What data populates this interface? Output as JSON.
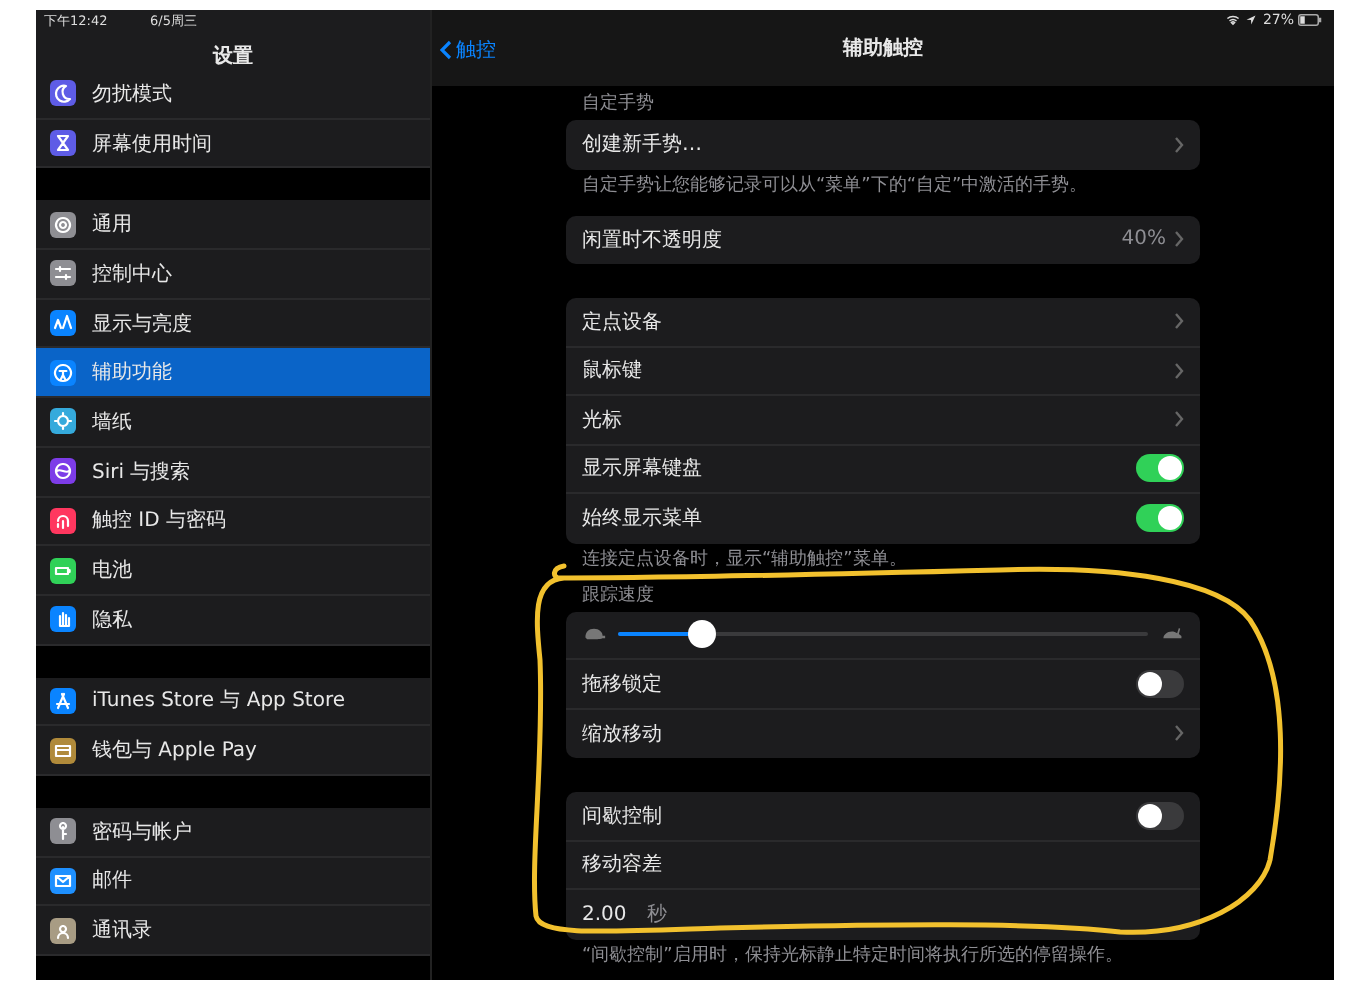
{
  "status_bar": {
    "time": "下午12:42",
    "date": "6/5周三",
    "battery": "27%"
  },
  "sidebar": {
    "title": "设置",
    "groups": [
      [
        {
          "label": "勿扰模式",
          "selected": false
        },
        {
          "label": "屏幕使用时间",
          "selected": false
        }
      ],
      [
        {
          "label": "通用",
          "selected": false
        },
        {
          "label": "控制中心",
          "selected": false
        },
        {
          "label": "显示与亮度",
          "selected": false
        },
        {
          "label": "辅助功能",
          "selected": true
        },
        {
          "label": "墙纸",
          "selected": false
        },
        {
          "label": "Siri 与搜索",
          "selected": false
        },
        {
          "label": "触控 ID 与密码",
          "selected": false
        },
        {
          "label": "电池",
          "selected": false
        },
        {
          "label": "隐私",
          "selected": false
        }
      ],
      [
        {
          "label": "iTunes Store 与 App Store",
          "selected": false
        },
        {
          "label": "钱包与 Apple Pay",
          "selected": false
        }
      ],
      [
        {
          "label": "密码与帐户",
          "selected": false
        },
        {
          "label": "邮件",
          "selected": false
        },
        {
          "label": "通讯录",
          "selected": false
        }
      ]
    ]
  },
  "nav": {
    "back": "触控",
    "title": "辅助触控"
  },
  "sections": [
    {
      "header": "自定手势",
      "rows": [
        {
          "kind": "link",
          "label": "创建新手势…"
        }
      ],
      "footer": "自定手势让您能够记录可以从“菜单”下的“自定”中激活的手势。"
    },
    {
      "rows": [
        {
          "kind": "value",
          "label": "闲置时不透明度",
          "value": "40%"
        }
      ]
    },
    {
      "rows": [
        {
          "kind": "link",
          "label": "定点设备"
        },
        {
          "kind": "link",
          "label": "鼠标键"
        },
        {
          "kind": "link",
          "label": "光标"
        },
        {
          "kind": "toggle",
          "label": "显示屏幕键盘",
          "on": true
        },
        {
          "kind": "toggle",
          "label": "始终显示菜单",
          "on": true
        }
      ],
      "footer": "连接定点设备时，显示“辅助触控”菜单。"
    },
    {
      "header": "跟踪速度",
      "rows": [
        {
          "kind": "slider",
          "level": 0.16
        },
        {
          "kind": "toggle",
          "label": "拖移锁定",
          "on": false
        },
        {
          "kind": "link",
          "label": "缩放移动"
        }
      ]
    },
    {
      "rows": [
        {
          "kind": "toggle",
          "label": "间歇控制",
          "on": false
        },
        {
          "kind": "plain",
          "label": "移动容差"
        },
        {
          "kind": "number",
          "value": "2.00",
          "unit": "秒"
        }
      ],
      "footer": "“间歇控制”启用时，保持光标静止特定时间将执行所选的停留操作。"
    }
  ]
}
